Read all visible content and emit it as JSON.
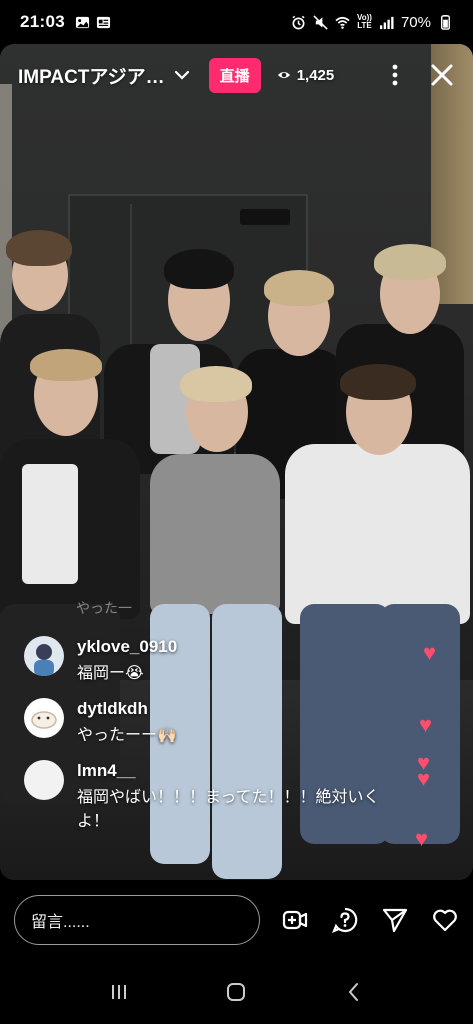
{
  "status": {
    "time": "21:03",
    "battery": "70%",
    "volte_top": "Vo))",
    "volte_bottom": "LTE"
  },
  "header": {
    "title": "IMPACTアジア…",
    "live_label": "直播",
    "viewer_count": "1,425"
  },
  "fade_comment": "やった一",
  "comments": [
    {
      "user": "yklove_0910",
      "message": "福岡ー😭"
    },
    {
      "user": "dytldkdh",
      "message": "やったーー🙌🏻"
    },
    {
      "user": "lmn4__",
      "message": "福岡やばい！！！まってた！！！絶対いくよ！"
    }
  ],
  "composer": {
    "placeholder": "留言......"
  },
  "colors": {
    "live_badge": "#ff2b6e",
    "heart": "#ff4d6d"
  },
  "icons": [
    "add-guest-icon",
    "question-icon",
    "send-icon",
    "heart-icon",
    "more-icon",
    "close-icon",
    "eye-icon",
    "chevron-down-icon"
  ]
}
